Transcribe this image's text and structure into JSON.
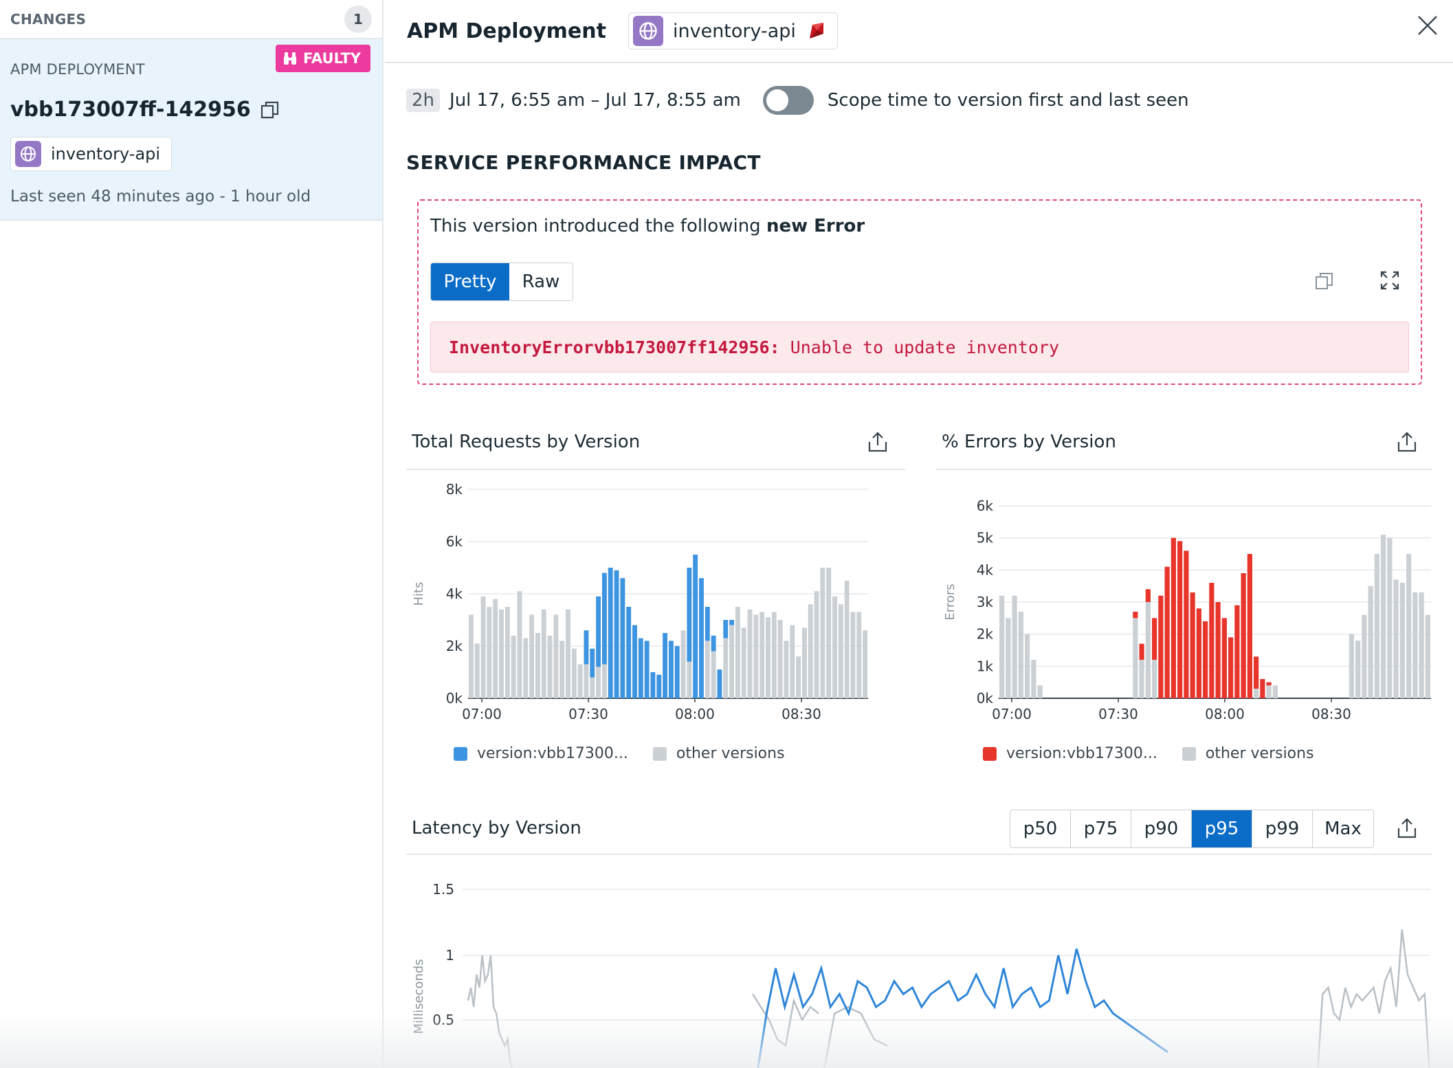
{
  "left_panel": {
    "title": "CHANGES",
    "count": "1",
    "card": {
      "type": "APM DEPLOYMENT",
      "badge": "FAULTY",
      "version": "vbb173007ff-142956",
      "service": "inventory-api",
      "last_seen": "Last seen 48 minutes ago - 1 hour old"
    }
  },
  "header": {
    "title": "APM Deployment",
    "service": "inventory-api"
  },
  "time": {
    "range_pill": "2h",
    "range": "Jul 17, 6:55 am – Jul 17, 8:55 am",
    "toggle_label": "Scope time to version first and last seen",
    "toggle_on": false
  },
  "section_title": "SERVICE PERFORMANCE IMPACT",
  "error": {
    "intro_prefix": "This version introduced the following",
    "intro_bold": "new Error",
    "tabs": [
      "Pretty",
      "Raw"
    ],
    "active_tab": "Pretty",
    "code_name": "InventoryErrorvbb173007ff142956:",
    "code_message": "Unable to update inventory"
  },
  "colors": {
    "version_requests": "#3d94e0",
    "version_errors": "#e8352b",
    "other_versions": "#cbd0d5",
    "latency_line": "#2f86d8",
    "accent": "#0b6cc8",
    "faulty": "#ec3a9e"
  },
  "chart_data": [
    {
      "type": "bar",
      "stacked": true,
      "title": "Total Requests by Version",
      "ylabel": "Hits",
      "ylim": [
        0,
        8000
      ],
      "yticks": [
        "0k",
        "2k",
        "4k",
        "6k",
        "8k"
      ],
      "xticks": [
        "07:00",
        "07:30",
        "08:00",
        "08:30"
      ],
      "legend": [
        "version:vbb17300...",
        "other versions"
      ],
      "series": [
        {
          "name": "version:vbb17300...",
          "values": [
            0,
            0,
            0,
            0,
            0,
            0,
            0,
            0,
            0,
            0,
            0,
            0,
            0,
            0,
            0,
            0,
            0,
            0,
            0,
            1300,
            1100,
            2700,
            3500,
            5000,
            4900,
            4600,
            3500,
            2800,
            2300,
            2200,
            1000,
            900,
            2500,
            2200,
            2000,
            0,
            3600,
            5500,
            4600,
            1300,
            600,
            1100,
            700,
            200,
            0,
            0,
            0,
            0,
            0,
            0,
            0,
            0,
            0,
            0,
            0,
            0,
            0,
            0,
            0,
            0,
            0,
            0
          ]
        },
        {
          "name": "other versions",
          "values": [
            3200,
            2100,
            3900,
            3500,
            3800,
            3400,
            3500,
            2400,
            4100,
            2300,
            3200,
            2500,
            3400,
            2400,
            3200,
            2200,
            3400,
            1900,
            1300,
            1300,
            800,
            1200,
            1300,
            0,
            0,
            0,
            0,
            0,
            0,
            0,
            0,
            0,
            0,
            0,
            0,
            2600,
            1400,
            0,
            0,
            2200,
            1800,
            0,
            2300,
            2800,
            3500,
            2700,
            3400,
            3200,
            3300,
            3100,
            3300,
            3000,
            2200,
            2800,
            1600,
            2700,
            3600,
            4100,
            5000,
            5000,
            3900,
            3600,
            4500,
            3300,
            3300,
            2600
          ]
        }
      ]
    },
    {
      "type": "bar",
      "stacked": true,
      "title": "% Errors by Version",
      "ylabel": "Errors",
      "ylim": [
        0,
        6000
      ],
      "yticks": [
        "0k",
        "1k",
        "2k",
        "3k",
        "4k",
        "5k",
        "6k"
      ],
      "xticks": [
        "07:00",
        "07:30",
        "08:00",
        "08:30"
      ],
      "legend": [
        "version:vbb17300...",
        "other versions"
      ],
      "series": [
        {
          "name": "version:vbb17300...",
          "values": [
            0,
            0,
            0,
            0,
            0,
            0,
            0,
            0,
            0,
            0,
            0,
            0,
            0,
            0,
            0,
            0,
            0,
            0,
            0,
            0,
            0,
            200,
            500,
            400,
            1300,
            3200,
            4100,
            5000,
            4900,
            4600,
            3300,
            2800,
            2400,
            3600,
            3000,
            2500,
            1900,
            2900,
            3900,
            4500,
            1000,
            600,
            100,
            0,
            0,
            0,
            0,
            0,
            0,
            0,
            0,
            0,
            0,
            0,
            0,
            0,
            0,
            0,
            0,
            0,
            0,
            0,
            0,
            0,
            0,
            0,
            0
          ]
        },
        {
          "name": "other versions",
          "values": [
            3200,
            2500,
            3200,
            2700,
            2000,
            1200,
            400,
            0,
            0,
            0,
            0,
            0,
            0,
            0,
            0,
            0,
            0,
            0,
            0,
            0,
            0,
            2500,
            1200,
            3000,
            1200,
            0,
            0,
            0,
            0,
            0,
            0,
            0,
            0,
            0,
            0,
            0,
            0,
            0,
            0,
            0,
            300,
            0,
            400,
            400,
            0,
            0,
            0,
            0,
            0,
            0,
            0,
            0,
            0,
            0,
            0,
            2000,
            1800,
            2600,
            3500,
            4500,
            5100,
            5000,
            3700,
            3600,
            4500,
            3300,
            3300,
            2600
          ]
        }
      ]
    },
    {
      "type": "line",
      "title": "Latency by Version",
      "ylabel": "Milliseconds",
      "yticks": [
        "0.5",
        "1",
        "1.5"
      ],
      "percentiles": [
        "p50",
        "p75",
        "p90",
        "p95",
        "p99",
        "Max"
      ],
      "selected_percentile": "p95",
      "series": [
        {
          "name": "version:vbb17300...",
          "values": [
            0.1,
            0.55,
            0.9,
            0.6,
            0.85,
            0.6,
            0.7,
            0.9,
            0.6,
            0.7,
            0.55,
            0.8,
            0.75,
            0.6,
            0.65,
            0.8,
            0.7,
            0.75,
            0.6,
            0.7,
            0.75,
            0.8,
            0.65,
            0.7,
            0.85,
            0.7,
            0.6,
            0.9,
            0.6,
            0.7,
            0.75,
            0.6,
            0.65,
            1.0,
            0.7,
            1.05,
            0.8,
            0.6,
            0.65,
            0.55,
            0.5,
            0.45,
            0.4,
            0.35,
            0.3,
            0.25
          ]
        },
        {
          "name": "other versions",
          "values": [
            0.65,
            0.75,
            0.6,
            0.85,
            0.75,
            1.0,
            0.8,
            0.85,
            1.0,
            0.6,
            0.55,
            0.4,
            0.35,
            0.3,
            0.35,
            0.15,
            0.1,
            0.0,
            0.7,
            0.6,
            0.5,
            0.35,
            0.3,
            0.65,
            0.5,
            0.6,
            0.55,
            0.0,
            0.55,
            0.6,
            0.55,
            0.35,
            0.3,
            0.0,
            0.7,
            0.75,
            0.55,
            0.5,
            0.75,
            0.6,
            0.7,
            0.65,
            0.7,
            0.75,
            0.55,
            0.8,
            0.9,
            0.6,
            1.2,
            0.85,
            0.75,
            0.65,
            0.7,
            0.0
          ]
        }
      ]
    }
  ]
}
